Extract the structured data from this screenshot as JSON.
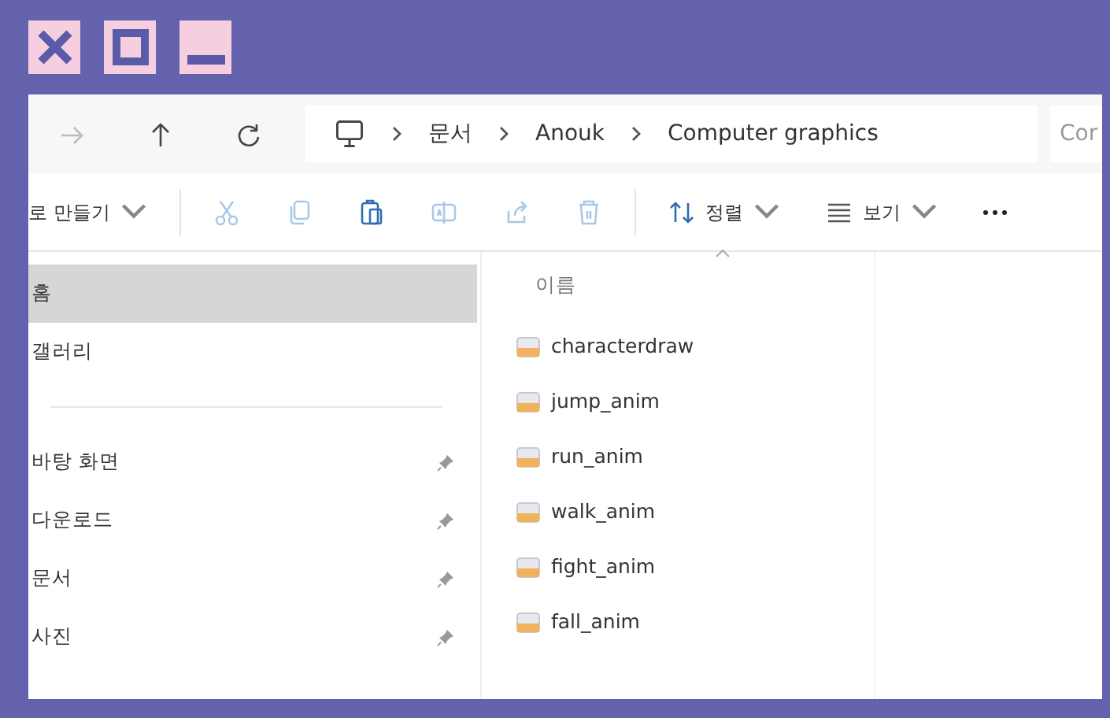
{
  "nav_buttons": [
    {
      "kind": "forward",
      "disabled": true
    },
    {
      "kind": "up",
      "disabled": false
    },
    {
      "kind": "refresh",
      "disabled": false
    }
  ],
  "breadcrumb": [
    "문서",
    "Anouk",
    "Computer graphics"
  ],
  "search": {
    "value": "Cor"
  },
  "toolbar": [
    {
      "kind": "new",
      "label": "로 만들기",
      "disabled": false
    },
    {
      "kind": "cut",
      "disabled": true
    },
    {
      "kind": "copy",
      "disabled": true
    },
    {
      "kind": "paste",
      "disabled": false
    },
    {
      "kind": "rename",
      "disabled": true
    },
    {
      "kind": "share",
      "disabled": true
    },
    {
      "kind": "delete",
      "disabled": true
    },
    {
      "kind": "sort",
      "label": "정렬",
      "disabled": false
    },
    {
      "kind": "view",
      "label": "보기",
      "disabled": false
    },
    {
      "kind": "more",
      "disabled": false
    }
  ],
  "sidebar": {
    "items": [
      {
        "label": "홈",
        "selected": true,
        "pinned": false
      },
      {
        "label": "갤러리",
        "selected": false,
        "pinned": false
      },
      {
        "kind": "divider"
      },
      {
        "label": "바탕 화면",
        "selected": false,
        "pinned": true
      },
      {
        "label": "다운로드",
        "selected": false,
        "pinned": true
      },
      {
        "label": "문서",
        "selected": false,
        "pinned": true
      },
      {
        "label": "사진",
        "selected": false,
        "pinned": true
      }
    ]
  },
  "file_list": {
    "column": "이름",
    "files": [
      "characterdraw",
      "jump_anim",
      "run_anim",
      "walk_anim",
      "fight_anim",
      "fall_anim"
    ]
  }
}
